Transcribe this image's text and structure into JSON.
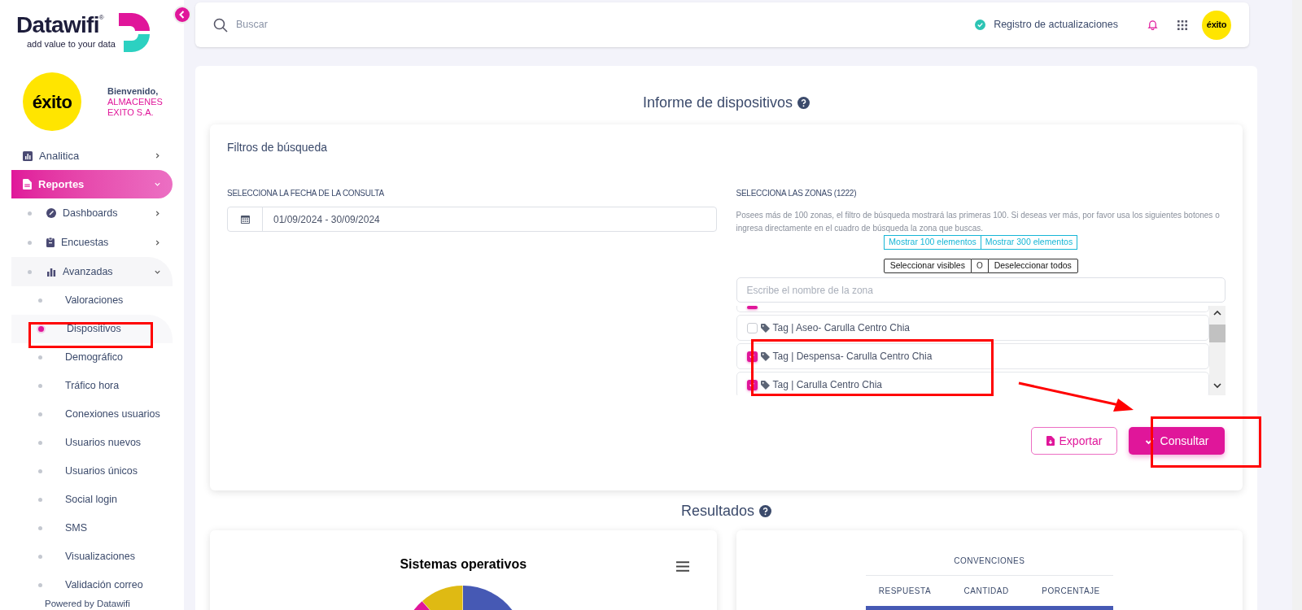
{
  "sidebar": {
    "brand": {
      "name": "Datawifi",
      "mark": "®",
      "tagline": "add value to your data"
    },
    "client_logo": "éxito",
    "welcome": "Bienvenido,",
    "company": "ALMACENES EXITO S.A.",
    "items": [
      {
        "label": "Analitica",
        "expanded": false,
        "selected": false
      },
      {
        "label": "Reportes",
        "expanded": true,
        "selected": true,
        "children": [
          {
            "label": "Dashboards",
            "expanded": false
          },
          {
            "label": "Encuestas",
            "expanded": false
          },
          {
            "label": "Avanzadas",
            "expanded": true,
            "children": [
              {
                "label": "Valoraciones",
                "selected": false
              },
              {
                "label": "Dispositivos",
                "selected": true
              },
              {
                "label": "Demográfico",
                "selected": false
              },
              {
                "label": "Tráfico hora",
                "selected": false
              },
              {
                "label": "Conexiones usuarios",
                "selected": false
              },
              {
                "label": "Usuarios nuevos",
                "selected": false
              },
              {
                "label": "Usuarios únicos",
                "selected": false
              },
              {
                "label": "Social login",
                "selected": false
              },
              {
                "label": "SMS",
                "selected": false
              },
              {
                "label": "Visualizaciones",
                "selected": false
              },
              {
                "label": "Validación correo",
                "selected": false
              }
            ]
          }
        ]
      }
    ],
    "footer": "Powered by Datawifi"
  },
  "topbar": {
    "search_placeholder": "Buscar",
    "updates": "Registro de actualizaciones",
    "user_logo": "éxito"
  },
  "report": {
    "title": "Informe de dispositivos",
    "filters": {
      "title": "Filtros de búsqueda",
      "date_label": "SELECCIONA LA FECHA DE LA CONSULTA",
      "date_value": "01/09/2024 - 30/09/2024",
      "zones_label": "SELECCIONA LAS ZONAS (1222)",
      "zones_note": "Posees más de 100 zonas, el filtro de búsqueda mostrará las primeras 100. Si deseas ver más, por favor usa los siguientes botones o ingresa directamente en el cuadro de búsqueda la zona que buscas.",
      "show_buttons": [
        "Mostrar 100 elementos",
        "Mostrar 300 elementos"
      ],
      "select_visible": "Seleccionar visibles",
      "separator": "O",
      "deselect_all": "Deseleccionar todos",
      "zone_placeholder": "Escribe el nombre de la zona",
      "zones": [
        {
          "checked": true
        },
        {
          "label": "Tag | Aseo- Carulla Centro Chia",
          "checked": false
        },
        {
          "label": "Tag | Despensa- Carulla Centro Chia",
          "checked": true
        },
        {
          "label": "Tag | Carulla Centro Chia",
          "checked": true
        }
      ],
      "export": "Exportar",
      "submit": "Consultar"
    },
    "results_title": "Resultados",
    "chart_title": "Sistemas operativos",
    "legend": {
      "title": "CONVENCIONES",
      "columns": [
        "RESPUESTA",
        "CANTIDAD",
        "PORCENTAJE"
      ]
    }
  }
}
